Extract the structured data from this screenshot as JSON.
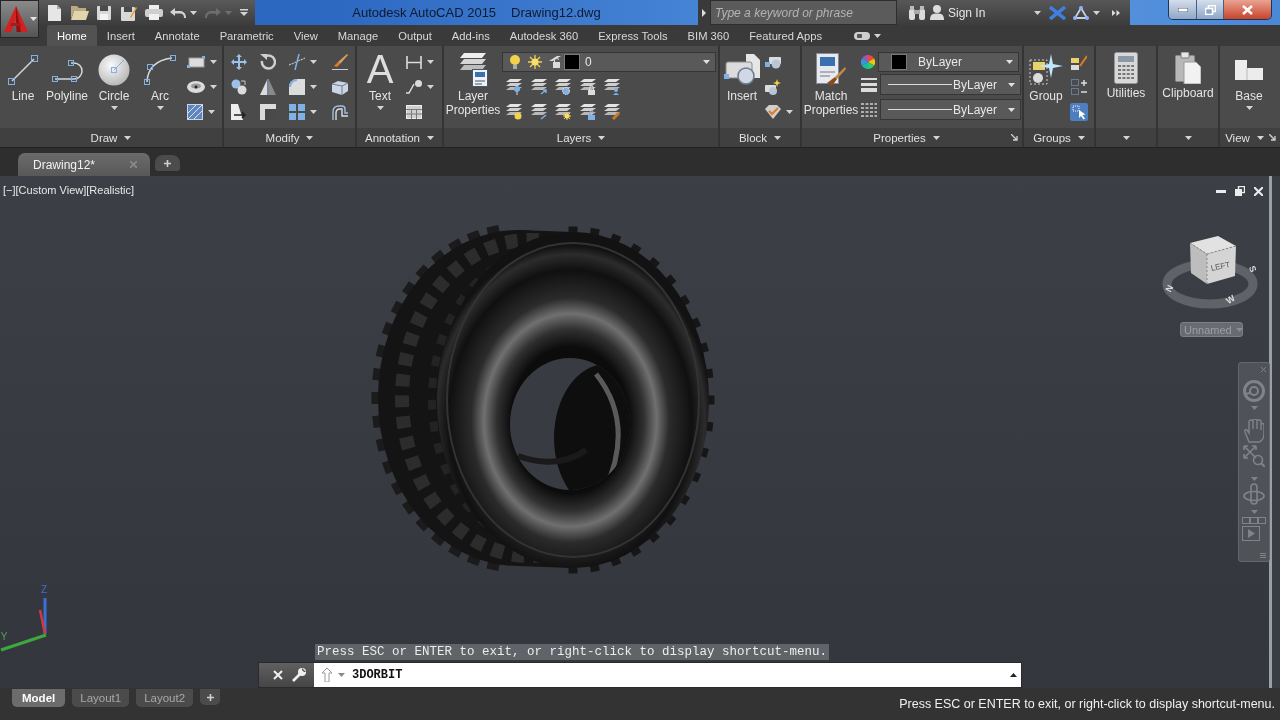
{
  "title_bar": {
    "title": "Autodesk AutoCAD 2015",
    "document": "Drawing12.dwg",
    "undo": {
      "disabled": false
    },
    "redo": {
      "disabled": true
    },
    "search": {
      "placeholder": "Type a keyword or phrase"
    },
    "sign_in": "Sign In"
  },
  "ribbon": {
    "tabs": [
      {
        "label": "Home",
        "selected": true
      },
      {
        "label": "Insert",
        "selected": false
      },
      {
        "label": "Annotate",
        "selected": false
      },
      {
        "label": "Parametric",
        "selected": false
      },
      {
        "label": "View",
        "selected": false
      },
      {
        "label": "Manage",
        "selected": false
      },
      {
        "label": "Output",
        "selected": false
      },
      {
        "label": "Add-ins",
        "selected": false
      },
      {
        "label": "Autodesk 360",
        "selected": false
      },
      {
        "label": "Express Tools",
        "selected": false
      },
      {
        "label": "BIM 360",
        "selected": false
      },
      {
        "label": "Featured Apps",
        "selected": false
      }
    ],
    "panels": [
      {
        "kind": "draw",
        "title": "Draw",
        "buttons": [
          "Line",
          "Polyline",
          "Circle",
          "Arc"
        ]
      },
      {
        "kind": "modify",
        "title": "Modify"
      },
      {
        "kind": "annotation",
        "title": "Annotation",
        "glyph": "A",
        "buttons": [
          "Text"
        ]
      },
      {
        "kind": "layers",
        "title": "Layers",
        "buttons": [
          "Layer Properties"
        ],
        "current_layer": "0"
      },
      {
        "kind": "block",
        "title": "Block",
        "buttons": [
          "Insert"
        ]
      },
      {
        "kind": "properties",
        "title": "Properties",
        "buttons": [
          "Match Properties"
        ],
        "dropdowns": [
          "ByLayer",
          "ByLayer",
          "ByLayer"
        ]
      },
      {
        "kind": "groups",
        "title": "Groups",
        "buttons": [
          "Group"
        ]
      },
      {
        "kind": "utilities",
        "buttons": [
          "Utilities"
        ]
      },
      {
        "kind": "clipboard",
        "buttons": [
          "Clipboard"
        ]
      },
      {
        "kind": "view",
        "title": "View",
        "buttons": [
          "Base"
        ]
      }
    ]
  },
  "file_tabs": [
    {
      "label": "Drawing12*",
      "selected": true
    }
  ],
  "viewport": {
    "menus": [
      "[−]",
      "[Custom View]",
      "[Realistic]"
    ],
    "viewcube": {
      "face": "LEFT",
      "compass": [
        "S",
        "N",
        "W"
      ]
    },
    "named_view": "Unnamed",
    "ucs_axes": [
      "Z",
      "Y"
    ]
  },
  "command_line": {
    "tooltip": "Press ESC or ENTER to exit, or right-click to display shortcut-menu.",
    "input": "3DORBIT"
  },
  "layout_tabs": [
    {
      "label": "Model",
      "selected": true
    },
    {
      "label": "Layout1",
      "selected": false
    },
    {
      "label": "Layout2",
      "selected": false
    }
  ],
  "status_bar": {
    "message": "Press ESC or ENTER to exit, or right-click to display shortcut-menu."
  }
}
